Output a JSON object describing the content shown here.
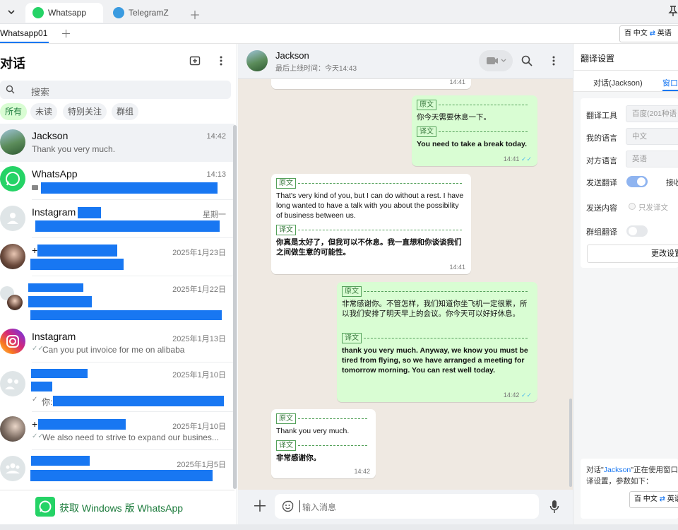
{
  "tabs": [
    {
      "label": "Whatsapp"
    },
    {
      "label": "TelegramZ"
    }
  ],
  "account_tab": "Whatsapp01",
  "lang_switch": {
    "from": "中文",
    "to": "英语",
    "engine_glyph": "百"
  },
  "left": {
    "title": "对话",
    "search_placeholder": "搜索",
    "filters": [
      "所有",
      "未读",
      "特别关注",
      "群组"
    ],
    "chats": [
      {
        "name": "Jackson",
        "time": "14:42",
        "message": "Thank you very much."
      },
      {
        "name": "WhatsApp",
        "time": "14:13",
        "message": ""
      },
      {
        "name": "Instagram",
        "time": "星期一",
        "message": ""
      },
      {
        "name": "+",
        "time": "2025年1月23日",
        "message": ""
      },
      {
        "name": "",
        "time": "2025年1月22日",
        "message": ""
      },
      {
        "name": "Instagram",
        "time": "2025年1月13日",
        "message": "Can you put invoice for me on alibaba"
      },
      {
        "name": "",
        "time": "2025年1月10日",
        "message": "你:"
      },
      {
        "name": "+",
        "time": "2025年1月10日",
        "message": "We also need to strive to expand our busines..."
      },
      {
        "name": "",
        "time": "2025年1月5日",
        "message": ""
      }
    ],
    "get_windows": "获取 Windows 版 WhatsApp"
  },
  "chat": {
    "contact": "Jackson",
    "last_seen": "最后上线时间：今天14:43",
    "composer_placeholder": "输入消息",
    "orig_tag": "原文",
    "trans_tag": "译文",
    "messages": [
      {
        "dir": "in",
        "time": "14:41",
        "original": "",
        "translation": ""
      },
      {
        "dir": "out",
        "time": "14:41",
        "original": "你今天需要休息一下。",
        "translation": "You need to take a break today."
      },
      {
        "dir": "in",
        "time": "14:41",
        "original": "That's very kind of you, but I can do without a rest. I have long wanted to have a talk with you about the possibility of business between us.",
        "translation": "你真是太好了，但我可以不休息。我一直想和你谈谈我们之间做生意的可能性。"
      },
      {
        "dir": "out",
        "time": "14:42",
        "original": "非常感谢你。不管怎样，我们知道你坐飞机一定很累，所以我们安排了明天早上的会议。你今天可以好好休息。",
        "translation": "thank you very much. Anyway, we know you must be tired from flying, so we have arranged a meeting for tomorrow morning. You can rest well today."
      },
      {
        "dir": "in",
        "time": "14:42",
        "original": "Thank you very much.",
        "translation": "非常感谢你。"
      }
    ]
  },
  "settings": {
    "title": "翻译设置",
    "tab_chat": "对话(Jackson)",
    "tab_window": "窗口",
    "rows": [
      {
        "label": "翻译工具",
        "value": "百度(201种语"
      },
      {
        "label": "我的语言",
        "value": "中文"
      },
      {
        "label": "对方语言",
        "value": "英语"
      }
    ],
    "send_translate": "发送翻译",
    "receive_short": "接收",
    "send_content": "发送内容",
    "send_only_trans": "只发译文",
    "group_translate": "群组翻译",
    "more_settings": "更改设置",
    "notice_prefix": "对话\"",
    "notice_name": "Jackson",
    "notice_suffix": "\"正在使用窗口",
    "notice_line2": "译设置，参数如下：",
    "notice_from": "中文",
    "notice_to": "英语"
  },
  "colors": {
    "accent": "#25d366",
    "brand_blue": "#1877f2",
    "out_bubble": "#d9fdd3"
  }
}
